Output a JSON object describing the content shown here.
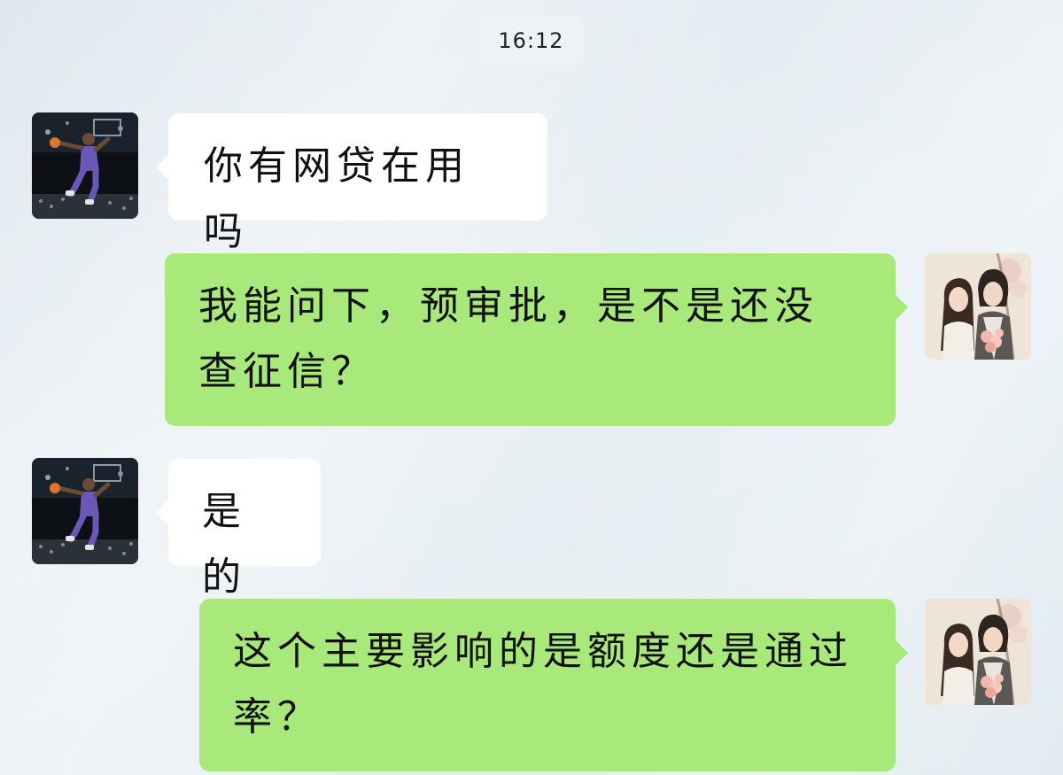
{
  "chat": {
    "timestamp": "16:12",
    "messages": [
      {
        "side": "incoming",
        "avatar": "basketball-dunk-avatar",
        "text": "你有网贷在用吗"
      },
      {
        "side": "outgoing",
        "avatar": "couple-illustration-avatar",
        "text": "我能问下，预审批，是不是还没查征信？"
      },
      {
        "side": "incoming",
        "avatar": "basketball-dunk-avatar",
        "text": "是的"
      },
      {
        "side": "outgoing",
        "avatar": "couple-illustration-avatar",
        "text": "这个主要影响的是额度还是通过率？"
      }
    ]
  },
  "colors": {
    "incoming_bubble": "#ffffff",
    "outgoing_bubble": "#a9e87a",
    "background": "#e6eef2"
  }
}
